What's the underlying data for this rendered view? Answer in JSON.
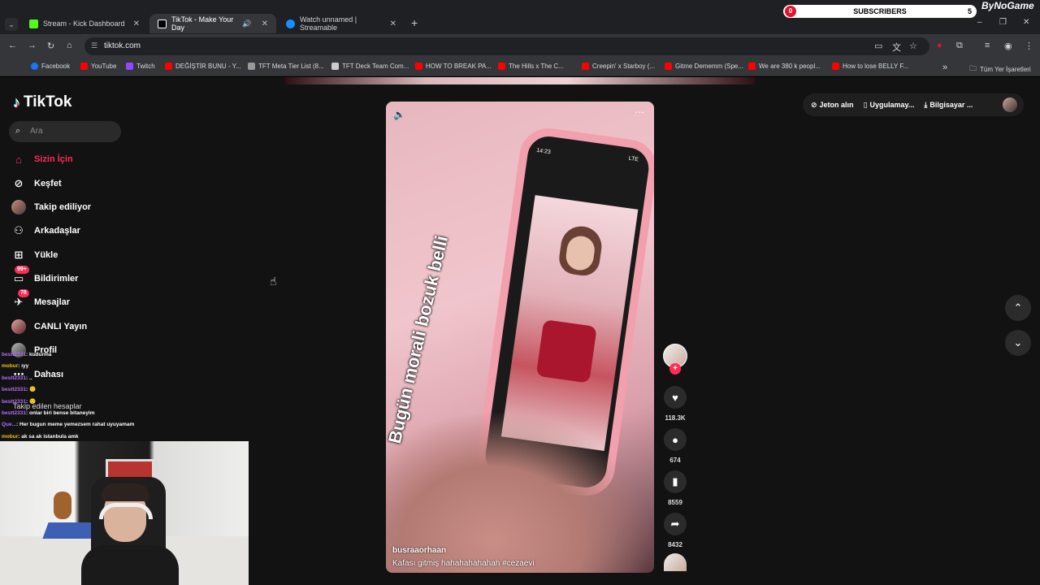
{
  "browser": {
    "tabs": [
      {
        "title": "Stream - Kick Dashboard",
        "color": "#53fc18"
      },
      {
        "title": "TikTok - Make Your Day",
        "color": "#ffffff"
      },
      {
        "title": "Watch unnamed | Streamable",
        "color": "#1a8cff"
      }
    ],
    "url": "tiktok.com",
    "bookmarks": [
      {
        "label": "Facebook",
        "color": "#1877f2"
      },
      {
        "label": "YouTube",
        "color": "#ff0000"
      },
      {
        "label": "Twitch",
        "color": "#9146ff"
      },
      {
        "label": "DEĞİŞTİR BUNU - Y...",
        "color": "#ff0000"
      },
      {
        "label": "TFT Meta Tier List (8...",
        "color": "#999999"
      },
      {
        "label": "TFT Deck Team Com...",
        "color": "#cccccc"
      },
      {
        "label": "HOW TO BREAK PA...",
        "color": "#ff0000"
      },
      {
        "label": "The Hills x The C...",
        "color": "#ff0000"
      },
      {
        "label": "Creepin' x Starboy (...",
        "color": "#ff0000"
      },
      {
        "label": "Gitme Dememm (Spe...",
        "color": "#ff0000"
      },
      {
        "label": "We are 380 k peopl...",
        "color": "#ff0000"
      },
      {
        "label": "How to lose BELLY F...",
        "color": "#ff0000"
      }
    ],
    "all_bookmarks": "Tüm Yer İşaretleri"
  },
  "overlay": {
    "subs_left": "0",
    "subs_label": "SUBSCRIBERS",
    "subs_right": "5",
    "brand": "ByNoGame",
    "chat": [
      {
        "user": "bestt2331",
        "msg": ": kudurma"
      },
      {
        "user": "mobur",
        "msg": ": ıyy"
      },
      {
        "user": "bestt2331",
        "msg": ": .."
      },
      {
        "user": "bestt2331",
        "msg": ": 🙂"
      },
      {
        "user": "bestt2331",
        "msg": ": 🙂"
      },
      {
        "user": "bestt2331",
        "msg": ": onlar biri bense bitaneyim"
      },
      {
        "user": "Que...",
        "msg": ": Her bugun meme yemezsem rahat uyuyamam"
      },
      {
        "user": "mobur",
        "msg": ": ak sa ak istanbula amk"
      }
    ]
  },
  "tiktok": {
    "logo": "TikTok",
    "search_placeholder": "Ara",
    "nav": [
      {
        "label": "Sizin İçin",
        "icon": "home-icon"
      },
      {
        "label": "Keşfet",
        "icon": "compass-icon"
      },
      {
        "label": "Takip ediliyor",
        "icon": "following-avatar"
      },
      {
        "label": "Arkadaşlar",
        "icon": "friends-icon"
      },
      {
        "label": "Yükle",
        "icon": "upload-icon"
      },
      {
        "label": "Bildirimler",
        "icon": "inbox-icon",
        "badge": "99+"
      },
      {
        "label": "Mesajlar",
        "icon": "messages-icon",
        "badge": "78"
      },
      {
        "label": "CANLI Yayın",
        "icon": "live-icon"
      },
      {
        "label": "Profil",
        "icon": "profile-icon"
      },
      {
        "label": "Dahası",
        "icon": "more-icon"
      }
    ],
    "following_header": "Takip edilen hesaplar",
    "top_actions": {
      "coins": "Jeton alın",
      "app": "Uygulamay...",
      "pc": "Bilgisayar ..."
    },
    "video": {
      "caption": "Bugün morali bozuk belli",
      "phone_time": "14:23",
      "phone_net": "LTE",
      "username": "busraaorhaan",
      "description": "Kafası gitmiş hahahahahahah #cezaevi"
    },
    "stats": {
      "likes": "118.3K",
      "comments": "674",
      "saves": "8559",
      "shares": "8432"
    }
  }
}
